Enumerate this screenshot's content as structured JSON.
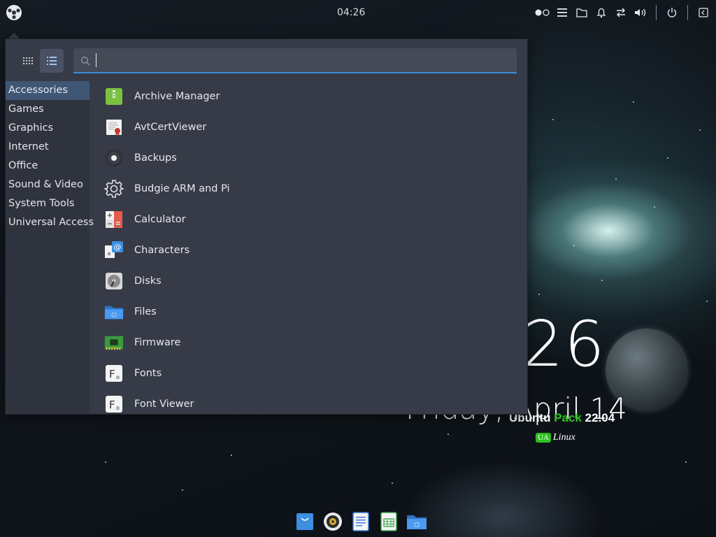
{
  "topbar": {
    "clock": "04:26",
    "tray_icons": [
      "workspace-switcher-icon",
      "menu-lines-icon",
      "folder-icon",
      "bell-icon",
      "network-icon",
      "volume-icon",
      "power-icon",
      "panel-toggle-icon"
    ]
  },
  "desktop": {
    "time_partial": "26",
    "date_partial": "Friday, April 14",
    "brand_word1": "Ubuntu",
    "brand_word2": "Pack",
    "brand_version": "22.04",
    "ua_badge": "UA",
    "linux_word": "Linux"
  },
  "menu": {
    "search_placeholder": "",
    "categories": [
      {
        "label": "Accessories",
        "active": true
      },
      {
        "label": "Games"
      },
      {
        "label": "Graphics"
      },
      {
        "label": "Internet"
      },
      {
        "label": "Office"
      },
      {
        "label": "Sound & Video"
      },
      {
        "label": "System Tools"
      },
      {
        "label": "Universal Access"
      }
    ],
    "apps": [
      {
        "label": "Archive Manager",
        "icon": "archive-manager-icon"
      },
      {
        "label": "AvtCertViewer",
        "icon": "certificate-icon"
      },
      {
        "label": "Backups",
        "icon": "backups-icon"
      },
      {
        "label": "Budgie ARM and Pi",
        "icon": "gear-icon"
      },
      {
        "label": "Calculator",
        "icon": "calculator-icon"
      },
      {
        "label": "Characters",
        "icon": "characters-icon"
      },
      {
        "label": "Disks",
        "icon": "disks-icon"
      },
      {
        "label": "Files",
        "icon": "files-icon"
      },
      {
        "label": "Firmware",
        "icon": "firmware-icon"
      },
      {
        "label": "Fonts",
        "icon": "fonts-icon"
      },
      {
        "label": "Font Viewer",
        "icon": "font-viewer-icon"
      }
    ]
  },
  "dock": {
    "items": [
      "software-store-icon",
      "rhythmbox-icon",
      "text-document-icon",
      "spreadsheet-icon",
      "file-manager-icon"
    ]
  },
  "colors": {
    "accent": "#3b8fd9",
    "menu_bg": "#363b47",
    "category_bg": "#2f333d",
    "active_category": "#3f5674",
    "brand_green": "#2ec01e"
  }
}
